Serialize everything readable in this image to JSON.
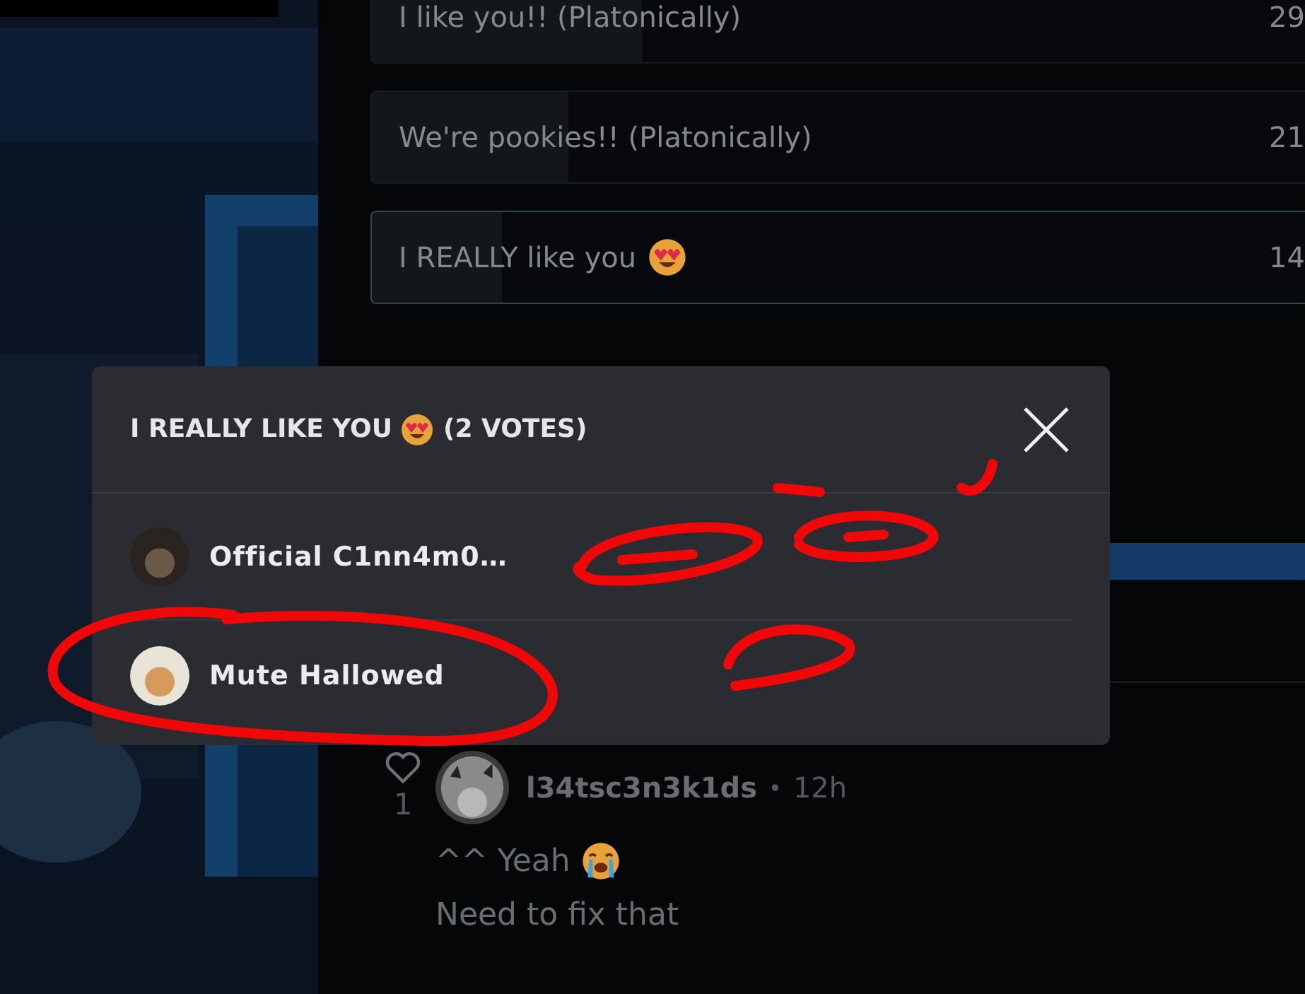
{
  "poll": {
    "options": [
      {
        "label": "I like you!! (Platonically)",
        "count": "29",
        "level": 0.29,
        "selected": false
      },
      {
        "label": "We're pookies!! (Platonically)",
        "count": "21",
        "level": 0.21,
        "selected": false
      },
      {
        "label": "I REALLY like you",
        "emoji": {
          "kind": "heart_eyes"
        },
        "count": "14",
        "level": 0.14,
        "selected": true
      }
    ]
  },
  "votes_modal": {
    "title": "I REALLY LIKE YOU",
    "title_emoji": {
      "kind": "heart_eyes"
    },
    "votes": "(2 VOTES)",
    "voters": [
      {
        "name": "Official C1nn4m0…",
        "avatar": {
          "kind": "dark"
        }
      },
      {
        "name": "Mute Hallowed",
        "avatar": {
          "kind": "light"
        }
      }
    ]
  },
  "comment": {
    "likes": "1",
    "author": "l34tsc3n3k1ds",
    "separator": "•",
    "time": "12h",
    "lines": [
      {
        "text": "^^ Yeah",
        "emoji": {
          "kind": "crying"
        }
      },
      {
        "text": "Need to fix that"
      }
    ]
  }
}
